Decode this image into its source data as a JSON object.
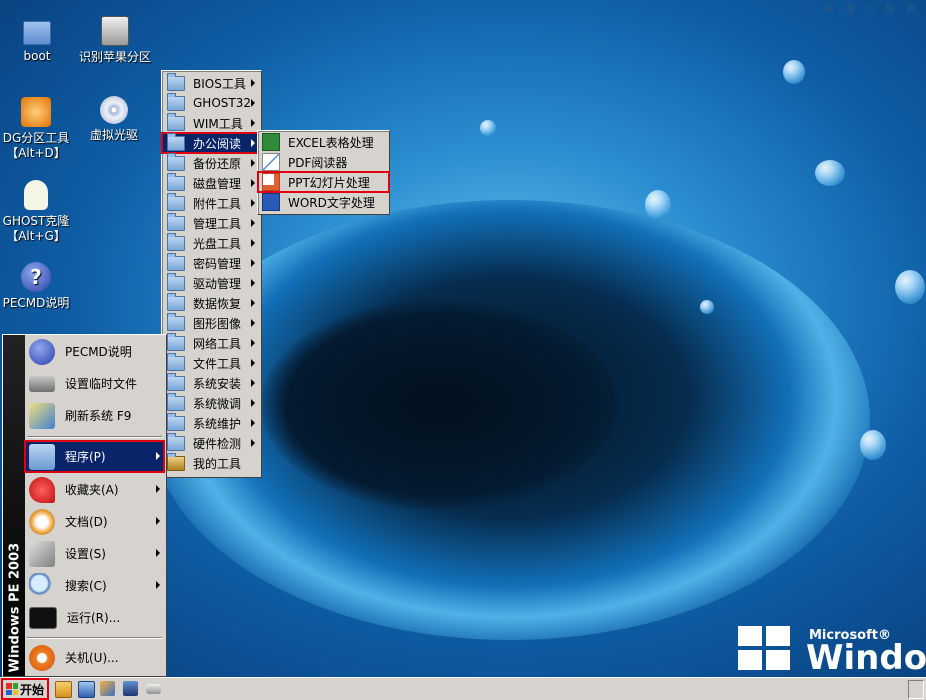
{
  "brand": {
    "logo_text": "U 深 度 U 盘 启"
  },
  "desktop_icons": [
    {
      "label": "boot",
      "icon": "folder-icon"
    },
    {
      "label": "识别苹果分区",
      "icon": "disk-tool-icon"
    },
    {
      "label": "DG分区工具\n【Alt+D】",
      "icon": "diskgenius-icon"
    },
    {
      "label": "虚拟光驱",
      "icon": "virtual-cd-icon"
    },
    {
      "label": "GHOST克隆\n【Alt+G】",
      "icon": "ghost-icon"
    },
    {
      "label": "PECMD说明",
      "icon": "help-icon"
    }
  ],
  "start_menu": {
    "sidebar_text": "Windows PE 2003",
    "items": [
      {
        "label": "PECMD说明",
        "icon": "help-icon"
      },
      {
        "label": "设置临时文件",
        "icon": "memory-icon"
      },
      {
        "label": "刷新系统 F9",
        "icon": "refresh-icon"
      },
      {
        "label": "程序(P)",
        "icon": "programs-icon"
      },
      {
        "label": "收藏夹(A)",
        "icon": "favorites-icon"
      },
      {
        "label": "文档(D)",
        "icon": "documents-icon"
      },
      {
        "label": "设置(S)",
        "icon": "settings-icon"
      },
      {
        "label": "搜索(C)",
        "icon": "search-icon"
      },
      {
        "label": "运行(R)...",
        "icon": "run-icon"
      },
      {
        "label": "关机(U)...",
        "icon": "shutdown-icon"
      }
    ]
  },
  "programs_menu": {
    "items": [
      "BIOS工具",
      "GHOST32",
      "WIM工具",
      "办公阅读",
      "备份还原",
      "磁盘管理",
      "附件工具",
      "管理工具",
      "光盘工具",
      "密码管理",
      "驱动管理",
      "数据恢复",
      "图形图像",
      "网络工具",
      "文件工具",
      "系统安装",
      "系统微调",
      "系统维护",
      "硬件检测",
      "我的工具"
    ]
  },
  "office_menu": {
    "items": [
      {
        "label": "EXCEL表格处理",
        "icon": "excel-icon"
      },
      {
        "label": "PDF阅读器",
        "icon": "pdf-icon"
      },
      {
        "label": "PPT幻灯片处理",
        "icon": "ppt-icon"
      },
      {
        "label": "WORD文字处理",
        "icon": "word-icon"
      }
    ]
  },
  "taskbar": {
    "start_label": "开始"
  },
  "wallpaper": {
    "ms_label": "Microsoft®",
    "win_label": "Windows"
  },
  "colors": {
    "highlight": "#0a246a",
    "red_box": "#e00010",
    "menu_bg": "#d6d3ce"
  }
}
